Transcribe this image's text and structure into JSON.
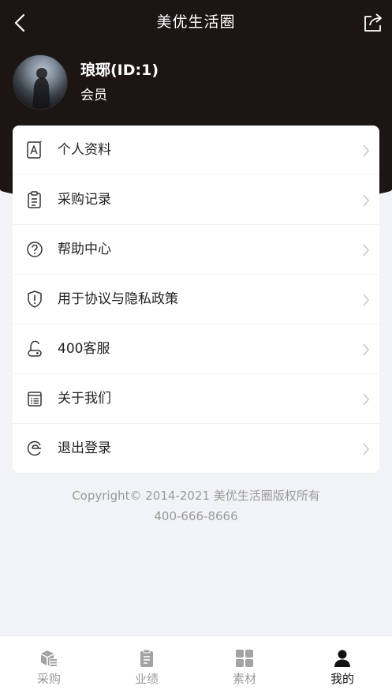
{
  "nav": {
    "title": "美优生活圈"
  },
  "user": {
    "name": "琅琊(ID:1)",
    "role": "会员"
  },
  "menu": [
    {
      "label": "个人资料",
      "icon": "profile-icon"
    },
    {
      "label": "采购记录",
      "icon": "clipboard-icon"
    },
    {
      "label": "帮助中心",
      "icon": "help-icon"
    },
    {
      "label": "用于协议与隐私政策",
      "icon": "shield-icon"
    },
    {
      "label": "400客服",
      "icon": "customer-service-icon"
    },
    {
      "label": "关于我们",
      "icon": "about-icon"
    },
    {
      "label": "退出登录",
      "icon": "logout-icon"
    }
  ],
  "footer": {
    "copyright": "Copyright© 2014-2021 美优生活圈版权所有",
    "phone": "400-666-8666"
  },
  "tabs": [
    {
      "label": "采购",
      "icon": "purchase-icon",
      "active": false
    },
    {
      "label": "业绩",
      "icon": "performance-icon",
      "active": false
    },
    {
      "label": "素材",
      "icon": "materials-icon",
      "active": false
    },
    {
      "label": "我的",
      "icon": "me-icon",
      "active": true
    }
  ],
  "colors": {
    "header_bg": "#1d1414",
    "page_bg": "#f2f3f6",
    "tab_inactive": "#999999",
    "tab_active": "#111111"
  }
}
